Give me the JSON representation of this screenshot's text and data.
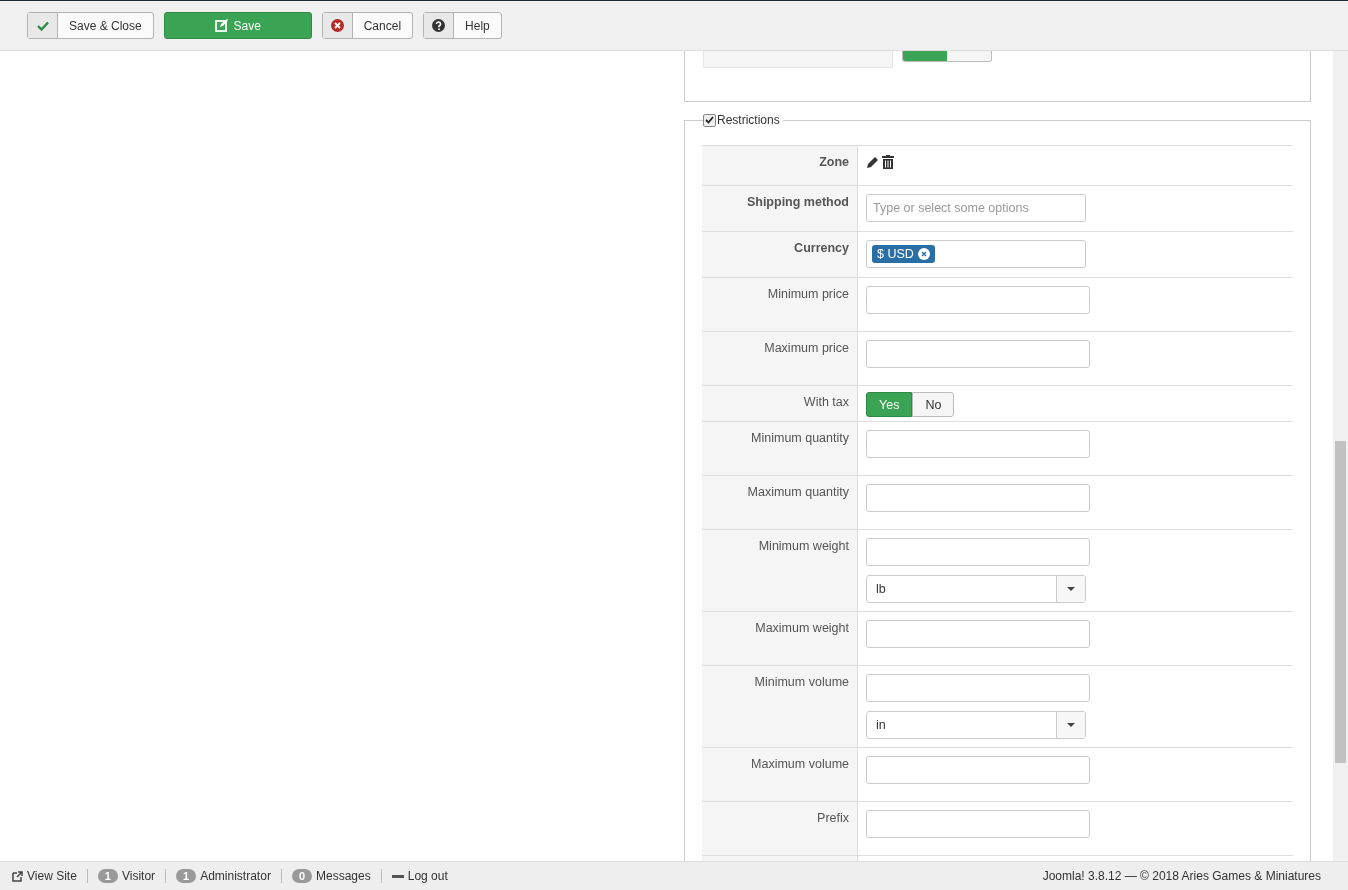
{
  "toolbar": [
    {
      "kind": "save-close",
      "label": "Save & Close"
    },
    {
      "kind": "save",
      "label": "Save"
    },
    {
      "kind": "cancel",
      "label": "Cancel"
    },
    {
      "kind": "help",
      "label": "Help"
    }
  ],
  "return_method": {
    "options": [
      {
        "selected": true
      },
      {
        "selected": false
      }
    ]
  },
  "restrictions": {
    "legend": "Restrictions",
    "checked": true,
    "rows": [
      {
        "kind": "icons",
        "label": "Zone",
        "bold": true
      },
      {
        "kind": "multiselect",
        "label": "Shipping method",
        "bold": true,
        "placeholder": "Type or select some options"
      },
      {
        "kind": "tags",
        "label": "Currency",
        "bold": true,
        "tags": [
          "$ USD"
        ]
      },
      {
        "kind": "text",
        "label": "Minimum price",
        "bold": false
      },
      {
        "kind": "text",
        "label": "Maximum price",
        "bold": false
      },
      {
        "kind": "toggle",
        "label": "With tax",
        "bold": false,
        "options": [
          {
            "label": "Yes",
            "selected": true
          },
          {
            "label": "No",
            "selected": false
          }
        ]
      },
      {
        "kind": "text",
        "label": "Minimum quantity",
        "bold": false
      },
      {
        "kind": "text",
        "label": "Maximum quantity",
        "bold": false
      },
      {
        "kind": "unit",
        "label": "Minimum weight",
        "bold": false,
        "unit": "lb"
      },
      {
        "kind": "text",
        "label": "Maximum weight",
        "bold": false
      },
      {
        "kind": "unit",
        "label": "Minimum volume",
        "bold": false,
        "unit": "in"
      },
      {
        "kind": "text",
        "label": "Maximum volume",
        "bold": false
      },
      {
        "kind": "text",
        "label": "Prefix",
        "bold": false
      }
    ]
  },
  "status_bar": {
    "left": [
      {
        "kind": "link",
        "text": "View Site"
      },
      {
        "kind": "badge",
        "count": "1",
        "text": "Visitor"
      },
      {
        "kind": "badge",
        "count": "1",
        "text": "Administrator"
      },
      {
        "kind": "badge",
        "count": "0",
        "text": "Messages"
      },
      {
        "kind": "logout",
        "text": "Log out"
      }
    ],
    "right": "Joomla! 3.8.12  —  © 2018 Aries Games & Miniatures"
  }
}
